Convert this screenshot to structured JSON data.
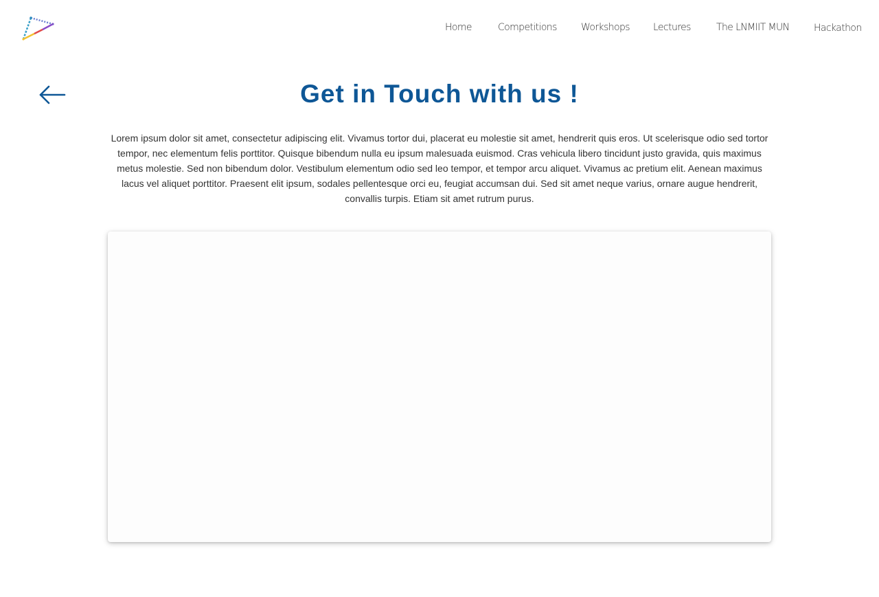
{
  "logo": {
    "icon": "triangle-dots-logo-icon"
  },
  "nav": {
    "items": [
      {
        "label": "Home"
      },
      {
        "label": "Competitions"
      },
      {
        "label": "Workshops"
      },
      {
        "label": "Lectures"
      },
      {
        "label": "The LNMIIT MUN"
      },
      {
        "label": "Hackathon"
      }
    ]
  },
  "page": {
    "back_icon": "arrow-left-icon",
    "title": "Get in Touch with us !",
    "description": "Lorem ipsum dolor sit amet, consectetur adipiscing elit. Vivamus tortor dui, placerat eu molestie sit amet, hendrerit quis eros. Ut scelerisque odio sed tortor tempor, nec elementum felis porttitor. Quisque bibendum nulla eu ipsum malesuada euismod. Cras vehicula libero tincidunt justo gravida, quis maximus metus molestie. Sed non bibendum dolor. Vestibulum elementum odio sed leo tempor, et tempor arcu aliquet. Vivamus ac pretium elit. Aenean maximus lacus vel aliquet porttitor. Praesent elit ipsum, sodales pellentesque orci eu, feugiat accumsan dui. Sed sit amet neque varius, ornare augue hendrerit, convallis turpis. Etiam sit amet rutrum purus."
  },
  "colors": {
    "accent": "#0e5796",
    "text": "#333333",
    "background": "#ffffff"
  }
}
